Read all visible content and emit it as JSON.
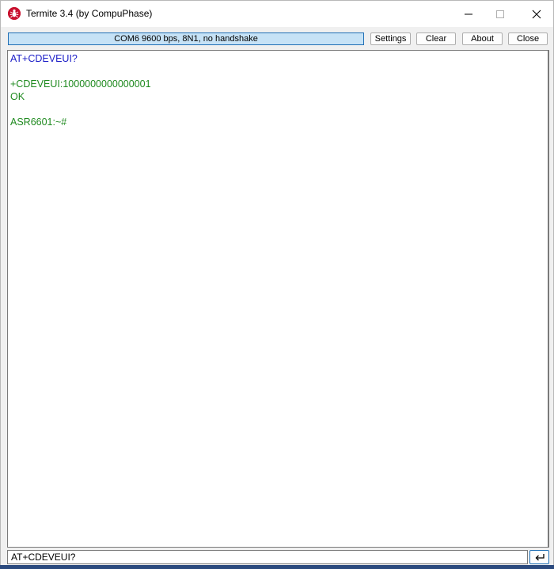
{
  "window": {
    "title": "Termite 3.4 (by CompuPhase)"
  },
  "toolbar": {
    "status": "COM6 9600 bps, 8N1, no handshake",
    "settings_label": "Settings",
    "clear_label": "Clear",
    "about_label": "About",
    "close_label": "Close"
  },
  "terminal": {
    "lines": [
      {
        "text": "AT+CDEVEUI?",
        "color": "#1e20c8"
      },
      {
        "text": "+CDEVEUI:1000000000000001",
        "color": "#1f8a1f"
      },
      {
        "text": "OK",
        "color": "#1f8a1f"
      },
      {
        "text": "ASR6601:~#",
        "color": "#1f8a1f"
      }
    ]
  },
  "input": {
    "value": "AT+CDEVEUI?"
  },
  "icons": {
    "app": "termite-icon",
    "minimize": "minimize-icon",
    "maximize": "maximize-icon",
    "close": "close-icon",
    "send": "enter-icon"
  },
  "colors": {
    "status_bg": "#c6e2f6",
    "status_border": "#1f6fb5",
    "sent_text": "#1e20c8",
    "received_text": "#1f8a1f"
  }
}
